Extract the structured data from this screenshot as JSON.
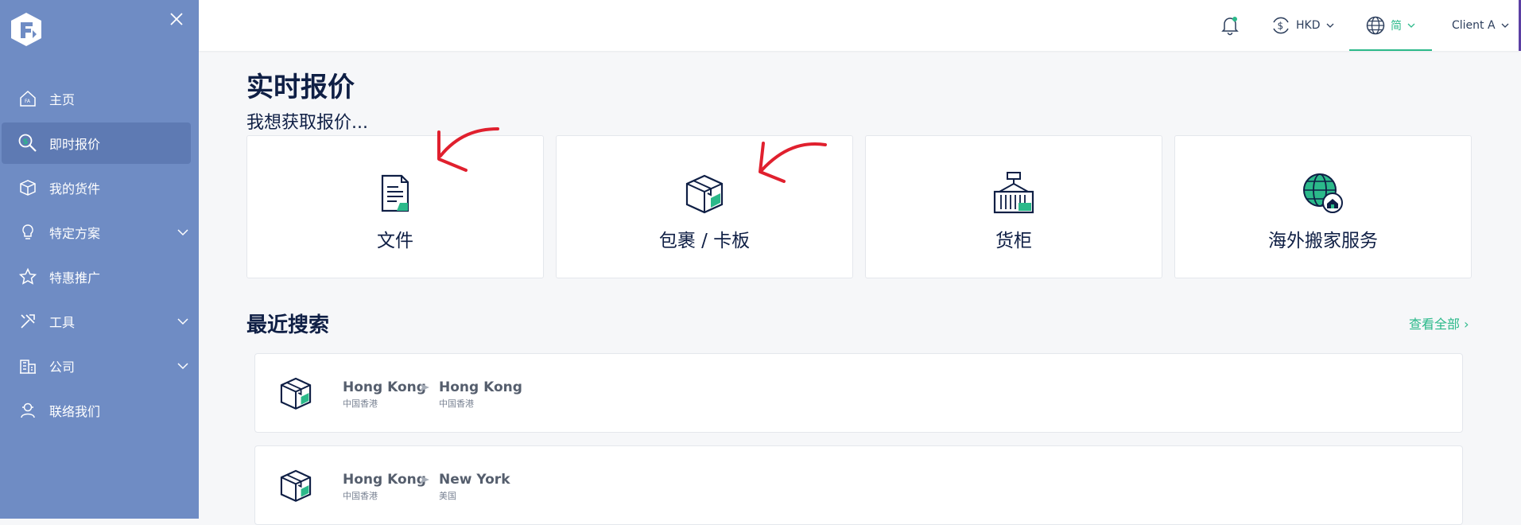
{
  "sidebar": {
    "items": [
      {
        "label": "主页",
        "icon": "home-icon"
      },
      {
        "label": "即时报价",
        "icon": "quote-search-icon"
      },
      {
        "label": "我的货件",
        "icon": "box-icon"
      },
      {
        "label": "特定方案",
        "icon": "lightbulb-icon"
      },
      {
        "label": "特惠推广",
        "icon": "star-icon"
      },
      {
        "label": "工具",
        "icon": "tools-icon"
      },
      {
        "label": "公司",
        "icon": "building-icon"
      },
      {
        "label": "联络我们",
        "icon": "contact-icon"
      }
    ]
  },
  "header": {
    "currency": "HKD",
    "language": "简",
    "user": "Client A"
  },
  "main": {
    "title": "实时报价",
    "subtitle": "我想获取报价...",
    "cards": [
      {
        "label": "文件",
        "icon": "document-icon"
      },
      {
        "label": "包裹 / 卡板",
        "icon": "parcel-icon"
      },
      {
        "label": "货柜",
        "icon": "container-icon"
      },
      {
        "label": "海外搬家服务",
        "icon": "globe-house-icon"
      }
    ],
    "recent_title": "最近搜索",
    "view_all": "查看全部 ›",
    "recent": [
      {
        "from_city": "Hong Kong",
        "from_country": "中国香港",
        "to_city": "Hong Kong",
        "to_country": "中国香港"
      },
      {
        "from_city": "Hong Kong",
        "from_country": "中国香港",
        "to_city": "New York",
        "to_country": "美国"
      }
    ]
  },
  "colors": {
    "sidebar": "#6f8cc4",
    "sidebar_active": "#5e7ab3",
    "accent": "#2bb98a",
    "navy": "#0f1f45",
    "annotation": "#e0202e"
  }
}
